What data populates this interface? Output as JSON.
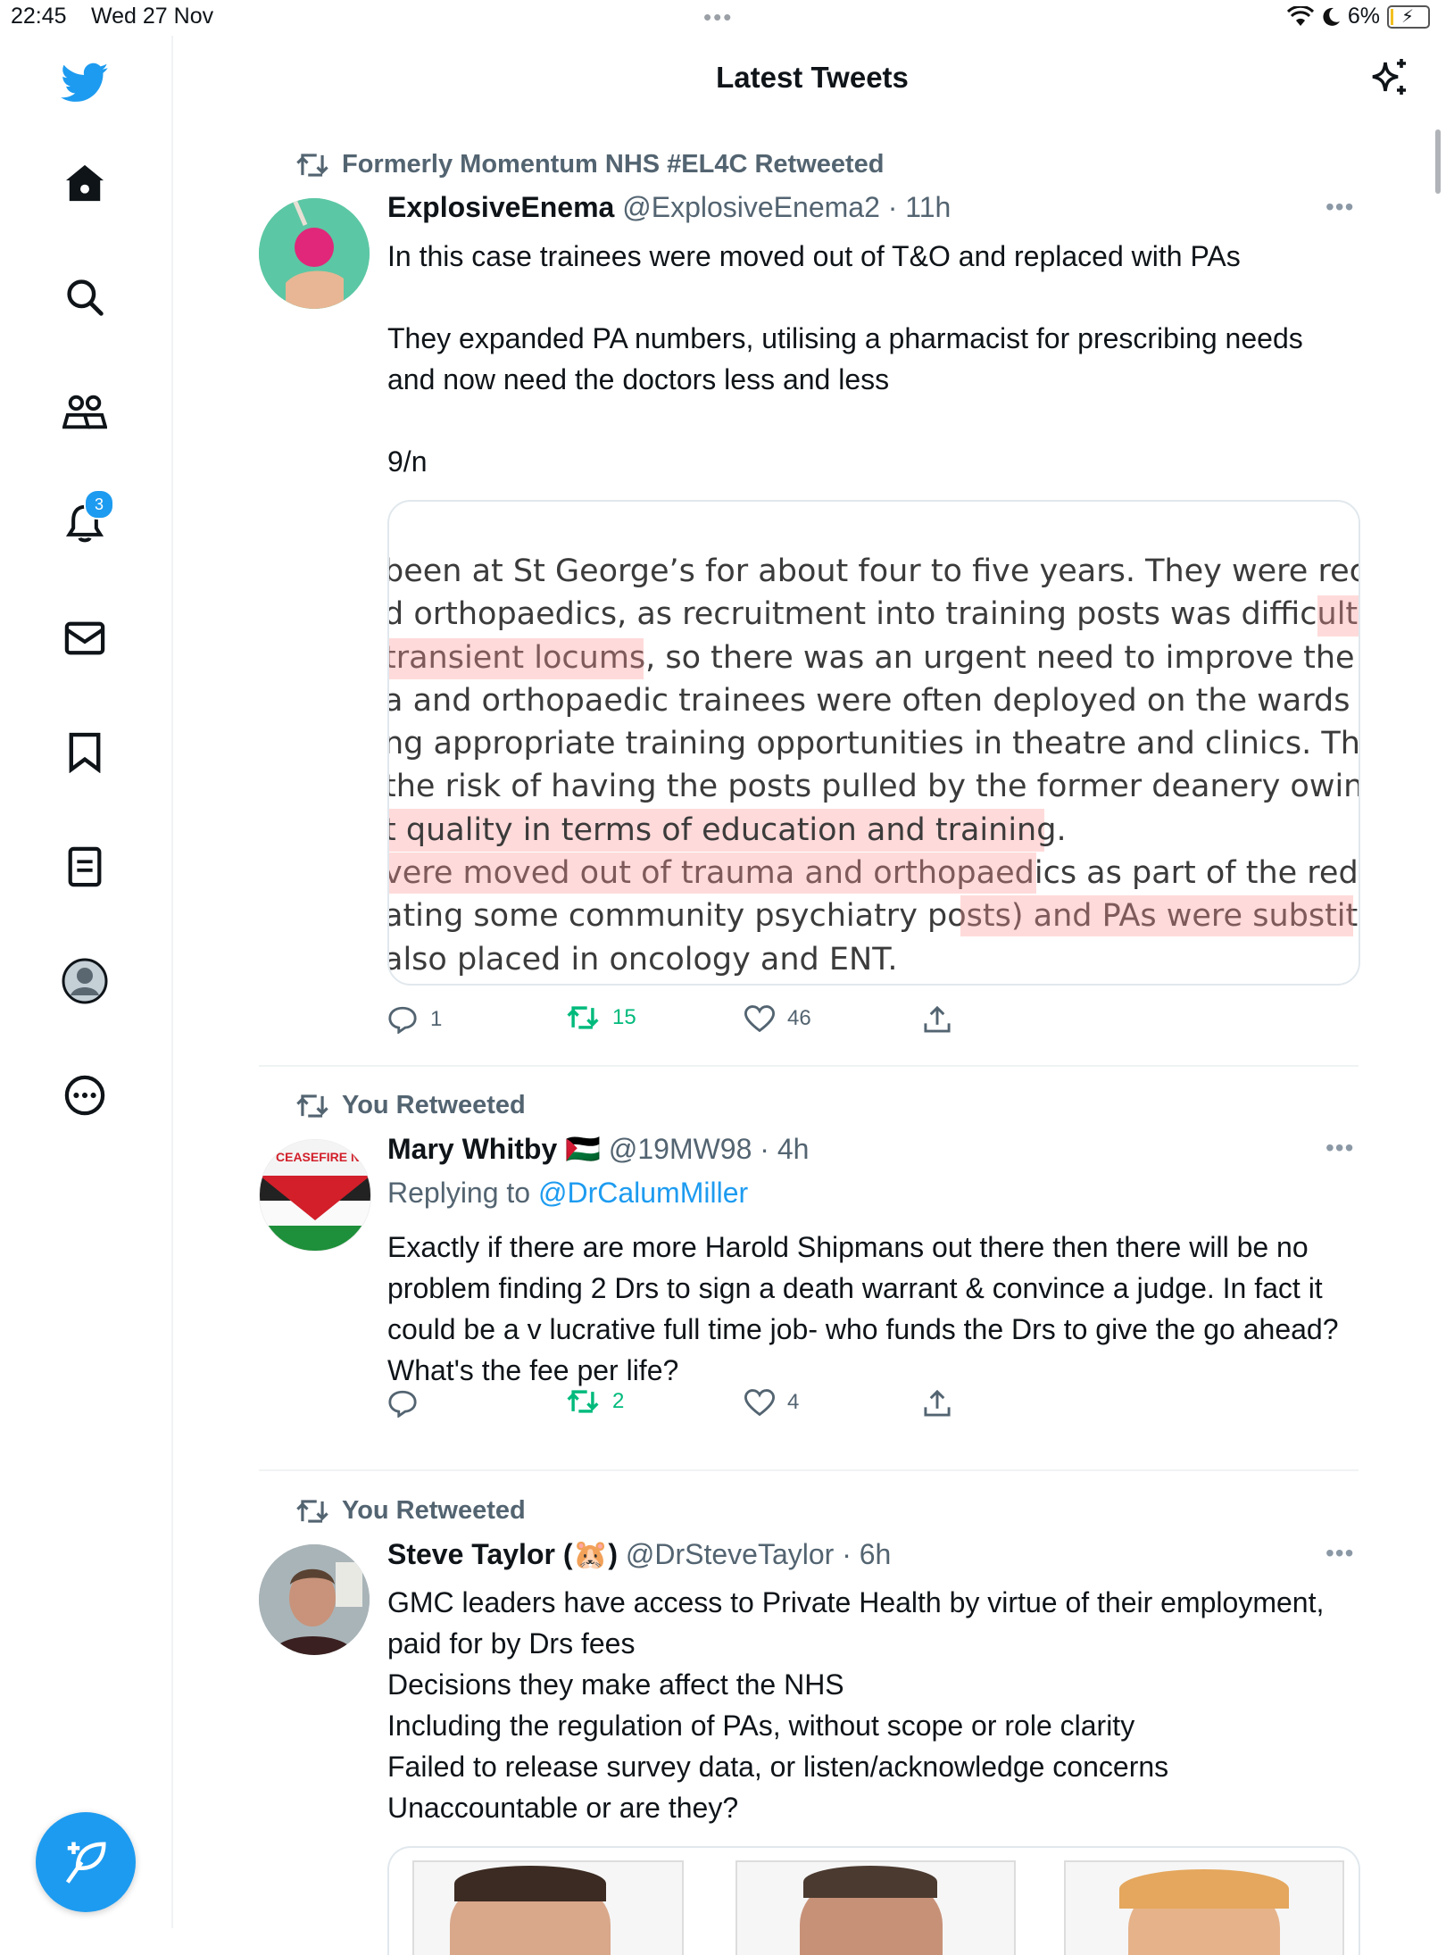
{
  "status_bar": {
    "time": "22:45",
    "date": "Wed 27 Nov",
    "battery": "6%"
  },
  "sidebar": {
    "notification_badge": "3",
    "items": [
      "home-icon",
      "search-icon",
      "communities-icon",
      "notifications-icon",
      "messages-icon",
      "bookmarks-icon",
      "lists-icon",
      "profile-icon",
      "more-icon"
    ]
  },
  "header": {
    "title": "Latest Tweets"
  },
  "colors": {
    "accent": "#1d9bf0",
    "retweet": "#00ba7c",
    "secondary_text": "#536471"
  },
  "tweets": [
    {
      "retweet_context": "Formerly Momentum NHS #EL4C Retweeted",
      "name": "ExplosiveEnema",
      "handle": "@ExplosiveEnema2 · 11h",
      "text": "In this case trainees were moved out of T&O and replaced with PAs\n\nThey expanded PA numbers, utilising a pharmacist for prescribing needs and now need the doctors less and less\n\n9/n",
      "image_lines": [
        "been at St George’s for about four to five years. They were recruited in",
        "d orthopaedics, as recruitment into training posts was difficult and th",
        "transient locums, so there was an urgent need to improve the situati",
        "a and orthopaedic trainees were often deployed on the wards inste",
        "ng appropriate training opportunities in theatre and clinics. This mea",
        " the risk of having the posts pulled by the former deanery owing to",
        "t quality in terms of education and training.",
        "vere moved out of trauma and orthopaedics as part of the redistribu",
        "ating some community psychiatry posts) and PAs were substituted.",
        "also placed in oncology and ENT."
      ],
      "replies": "1",
      "retweets": "15",
      "likes": "46"
    },
    {
      "retweet_context": "You Retweeted",
      "name": "Mary Whitby 🇵🇸",
      "handle": "@19MW98 · 4h",
      "replying_prefix": "Replying to",
      "replying_to": "@DrCalumMiller",
      "avatar_text": "CEASEFIRE NOW",
      "text": "Exactly if there are more Harold Shipmans out there then there will be no problem finding 2 Drs to sign a death warrant & convince a judge. In fact it could be a v lucrative full time job- who funds the Drs to give the go ahead? What's the fee per life?",
      "replies": "",
      "retweets": "2",
      "likes": "4"
    },
    {
      "retweet_context": "You Retweeted",
      "name": "Steve Taylor (🐹)",
      "handle": "@DrSteveTaylor · 6h",
      "text": "GMC leaders have access to Private Health by virtue of their employment, paid for by Drs fees\nDecisions they make affect the NHS\nIncluding the regulation of PAs, without scope or role clarity\nFailed to release survey data, or listen/acknowledge concerns\nUnaccountable or are they?"
    }
  ]
}
